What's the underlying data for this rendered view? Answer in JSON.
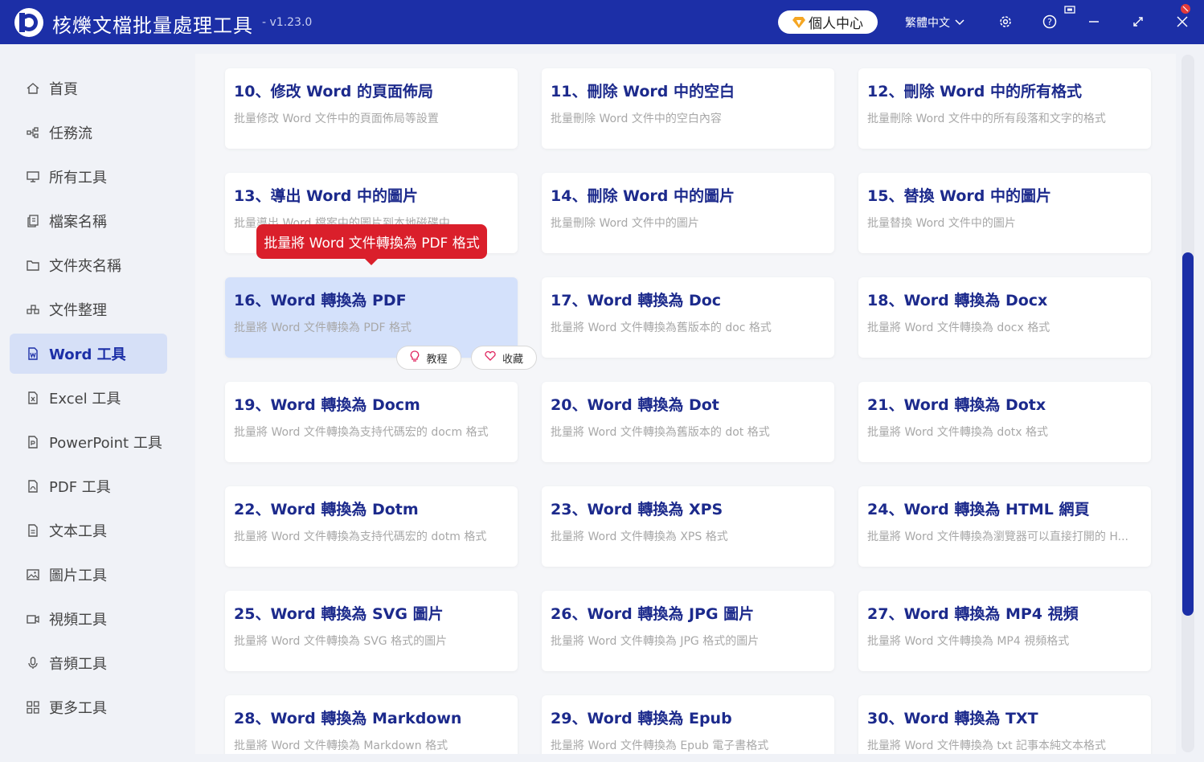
{
  "app": {
    "title": "核爍文檔批量處理工具",
    "version": "- v1.23.0",
    "user_center": "個人中心",
    "language": "繁體中文"
  },
  "sidebar": {
    "items": [
      {
        "label": "首頁",
        "icon": "home-icon"
      },
      {
        "label": "任務流",
        "icon": "workflow-icon"
      },
      {
        "label": "所有工具",
        "icon": "monitor-icon"
      },
      {
        "label": "檔案名稱",
        "icon": "file-copy-icon"
      },
      {
        "label": "文件夾名稱",
        "icon": "folder-icon"
      },
      {
        "label": "文件整理",
        "icon": "organize-icon"
      },
      {
        "label": "Word 工具",
        "icon": "word-icon",
        "active": true
      },
      {
        "label": "Excel 工具",
        "icon": "excel-icon"
      },
      {
        "label": "PowerPoint 工具",
        "icon": "ppt-icon"
      },
      {
        "label": "PDF 工具",
        "icon": "pdf-icon"
      },
      {
        "label": "文本工具",
        "icon": "text-icon"
      },
      {
        "label": "圖片工具",
        "icon": "image-icon"
      },
      {
        "label": "視頻工具",
        "icon": "video-icon"
      },
      {
        "label": "音頻工具",
        "icon": "mic-icon"
      },
      {
        "label": "更多工具",
        "icon": "grid-icon"
      }
    ]
  },
  "tools": [
    {
      "title": "10、修改 Word 的頁面佈局",
      "desc": "批量修改 Word 文件中的頁面佈局等設置"
    },
    {
      "title": "11、刪除 Word 中的空白",
      "desc": "批量刪除 Word 文件中的空白內容"
    },
    {
      "title": "12、刪除 Word 中的所有格式",
      "desc": "批量刪除 Word 文件中的所有段落和文字的格式"
    },
    {
      "title": "13、導出 Word 中的圖片",
      "desc": "批量導出 Word 檔案中的圖片到本地磁碟中"
    },
    {
      "title": "14、刪除 Word 中的圖片",
      "desc": "批量刪除 Word 文件中的圖片"
    },
    {
      "title": "15、替換 Word 中的圖片",
      "desc": "批量替換 Word 文件中的圖片"
    },
    {
      "title": "16、Word 轉換為 PDF",
      "desc": "批量將 Word 文件轉換為 PDF 格式",
      "selected": true
    },
    {
      "title": "17、Word 轉換為 Doc",
      "desc": "批量將 Word 文件轉換為舊版本的 doc 格式"
    },
    {
      "title": "18、Word 轉換為 Docx",
      "desc": "批量將 Word 文件轉換為 docx 格式"
    },
    {
      "title": "19、Word 轉換為 Docm",
      "desc": "批量將 Word 文件轉換為支持代碼宏的 docm 格式"
    },
    {
      "title": "20、Word 轉換為 Dot",
      "desc": "批量將 Word 文件轉換為舊版本的 dot 格式"
    },
    {
      "title": "21、Word 轉換為 Dotx",
      "desc": "批量將 Word 文件轉換為 dotx 格式"
    },
    {
      "title": "22、Word 轉換為 Dotm",
      "desc": "批量將 Word 文件轉換為支持代碼宏的 dotm 格式"
    },
    {
      "title": "23、Word 轉換為 XPS",
      "desc": "批量將 Word 文件轉換為 XPS 格式"
    },
    {
      "title": "24、Word 轉換為 HTML 網頁",
      "desc": "批量將 Word 文件轉換為瀏覽器可以直接打開的 H..."
    },
    {
      "title": "25、Word 轉換為 SVG 圖片",
      "desc": "批量將 Word 文件轉換為 SVG 格式的圖片"
    },
    {
      "title": "26、Word 轉換為 JPG 圖片",
      "desc": "批量將 Word 文件轉換為 JPG 格式的圖片"
    },
    {
      "title": "27、Word 轉換為 MP4 視頻",
      "desc": "批量將 Word 文件轉換為 MP4 視頻格式"
    },
    {
      "title": "28、Word 轉換為 Markdown",
      "desc": "批量將 Word 文件轉換為 Markdown 格式"
    },
    {
      "title": "29、Word 轉換為 Epub",
      "desc": "批量將 Word 文件轉換為 Epub 電子書格式"
    },
    {
      "title": "30、Word 轉換為 TXT",
      "desc": "批量將 Word 文件轉換為 txt 記事本純文本格式"
    }
  ],
  "tooltip": "批量將 Word 文件轉換為 PDF 格式",
  "card_actions": {
    "tutorial": "教程",
    "favorite": "收藏"
  },
  "colors": {
    "brand": "#1c2fa7",
    "card_title": "#1c2a8c",
    "tooltip": "#da1f2b",
    "selected_card": "#d4e1fb"
  }
}
